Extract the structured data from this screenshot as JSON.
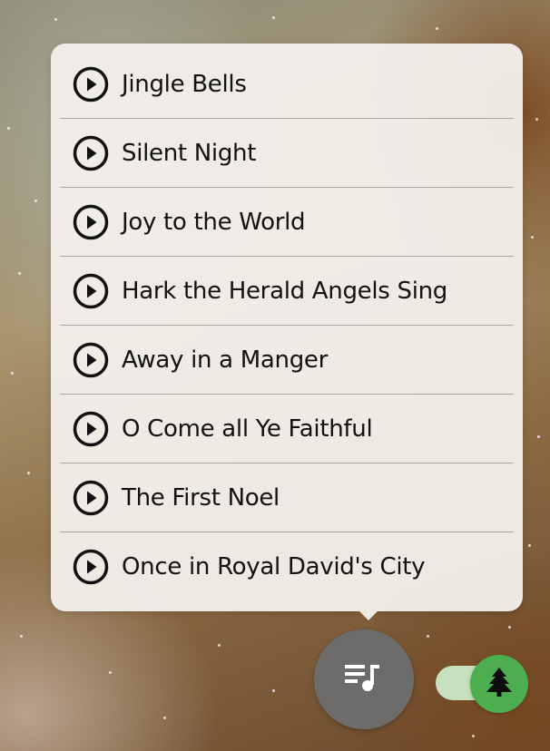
{
  "playlist": {
    "songs": [
      {
        "title": "Jingle Bells",
        "icon": "play-circle-icon"
      },
      {
        "title": "Silent Night",
        "icon": "play-circle-icon"
      },
      {
        "title": "Joy to the World",
        "icon": "play-circle-icon"
      },
      {
        "title": "Hark the Herald Angels Sing",
        "icon": "play-circle-icon"
      },
      {
        "title": "Away in a Manger",
        "icon": "play-circle-icon"
      },
      {
        "title": "O Come all Ye Faithful",
        "icon": "play-circle-icon"
      },
      {
        "title": "The First Noel",
        "icon": "play-circle-icon"
      },
      {
        "title": "Once in Royal David's City",
        "icon": "play-circle-icon"
      }
    ]
  },
  "controls": {
    "playlist_button_icon": "queue-music-icon",
    "tree_toggle_icon": "pine-tree-icon",
    "tree_toggle_on": true
  },
  "colors": {
    "popup_background": "#f2eeea",
    "fab_background": "#6e6c6a",
    "toggle_thumb": "#4cae4f",
    "toggle_track": "#c7e0bd",
    "text": "#111111"
  }
}
